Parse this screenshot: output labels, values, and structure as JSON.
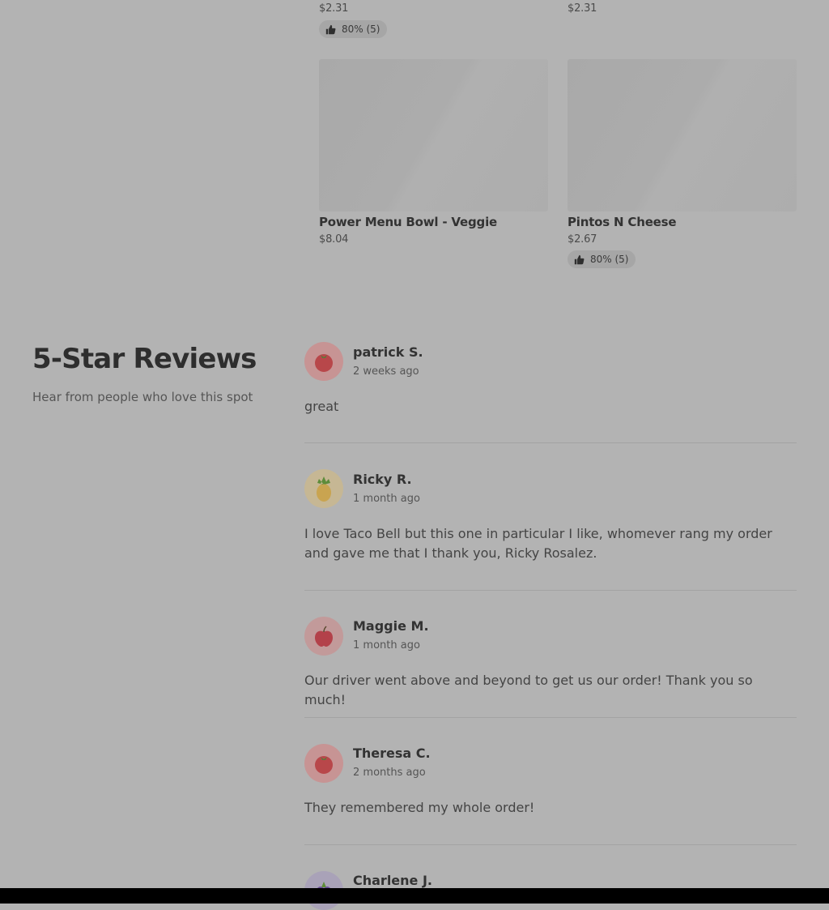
{
  "menu": {
    "top_items": [
      {
        "price": "$2.31",
        "rating": "80% (5)"
      },
      {
        "price": "$2.31"
      }
    ],
    "items": [
      {
        "name": "Power Menu Bowl - Veggie",
        "price": "$8.04"
      },
      {
        "name": "Pintos N Cheese",
        "price": "$2.67",
        "rating": "80% (5)"
      }
    ]
  },
  "reviews_section": {
    "title": "5-Star Reviews",
    "subtitle": "Hear from people who love this spot",
    "reviews": [
      {
        "name": "patrick S.",
        "time": "2 weeks ago",
        "text": "great",
        "avatar": "tomato-icon",
        "color": "#c79494"
      },
      {
        "name": "Ricky R.",
        "time": "1 month ago",
        "text": "I love Taco Bell but this one in particular I like, whomever rang my order and gave me that I thank you, Ricky Rosalez.",
        "avatar": "pineapple-icon",
        "color": "#c6b794"
      },
      {
        "name": "Maggie M.",
        "time": "1 month ago",
        "text": "Our driver went above and beyond to get us our order! Thank you so much!",
        "avatar": "apple-icon",
        "color": "#c29a9a"
      },
      {
        "name": "Theresa C.",
        "time": "2 months ago",
        "text": "They remembered my whole order!",
        "avatar": "tomato-icon",
        "color": "#c79494"
      },
      {
        "name": "Charlene J.",
        "avatar": "grapes-icon",
        "color": "#a9a2b8"
      }
    ]
  }
}
